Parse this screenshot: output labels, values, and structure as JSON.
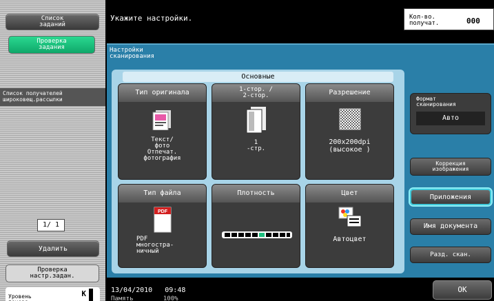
{
  "left": {
    "job_list": "Список\nзаданий",
    "job_check": "Проверка\nзадания",
    "recipients_list": "Список получателей\nшироковещ.рассылки",
    "page_indicator": "1/ 1",
    "delete": "Удалить",
    "check_settings": "Проверка\nнастр.задан.",
    "toner_label": "Уровень\nтонера",
    "toner_color": "K"
  },
  "header": {
    "message": "Укажите настройки.",
    "copies_label": "Кол-во.\nполучат.",
    "copies_value": "000"
  },
  "panel": {
    "title": "Настройки\nсканирования",
    "tab": "Основные",
    "buttons": [
      {
        "title": "Тип оригинала",
        "value": "Текст/\nфото\nОтпечат.\nфотография",
        "icon": "text-photo-document-icon"
      },
      {
        "title": "1-стор. /\n2-стор.",
        "value": "1\n-стр.",
        "icon": "single-sided-page-icon"
      },
      {
        "title": "Разрешение",
        "value": "200x200dpi\n(высокое )",
        "icon": "resolution-grid-icon"
      },
      {
        "title": "Тип файла",
        "value": "PDF\nмногостра-\nничный",
        "icon": "pdf-file-icon"
      },
      {
        "title": "Плотность",
        "value": "",
        "icon": "density-scale-icon"
      },
      {
        "title": "Цвет",
        "value": "Автоцвет",
        "icon": "auto-color-icon"
      }
    ],
    "scan_format_label": "Формат\nсканирования",
    "scan_format_value": "Авто",
    "image_correction": "Коррекция\nизображения",
    "applications": "Приложения",
    "document_name": "Имя документа",
    "separate_scan": "Разд. скан."
  },
  "footer": {
    "datetime": "13/04/2010   09:48",
    "memory": "Память        100%",
    "ok": "OK"
  }
}
